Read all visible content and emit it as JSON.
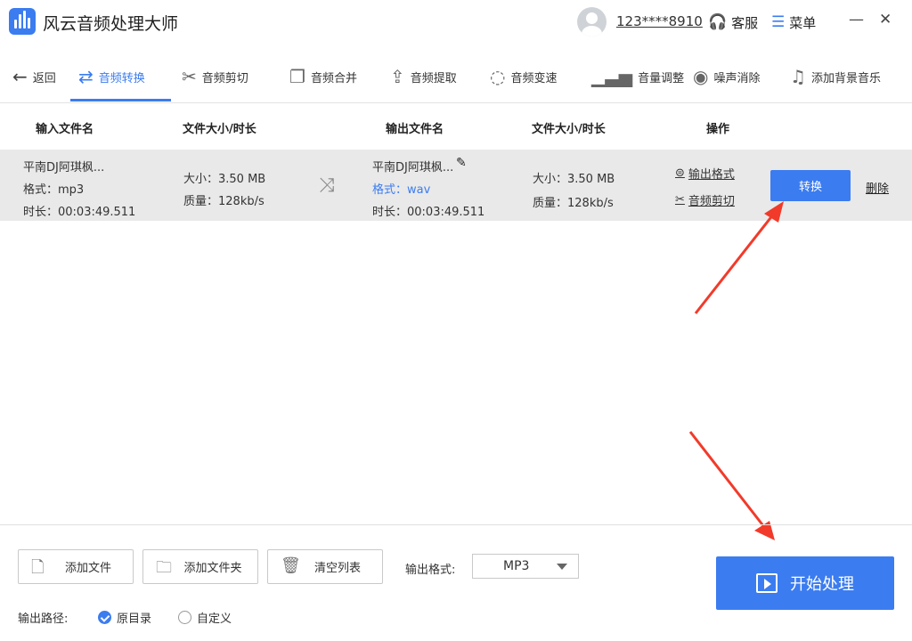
{
  "app": {
    "title": "风云音频处理大师",
    "user_id": "123****8910",
    "service_label": "客服",
    "menu_label": "菜单"
  },
  "toolbar": {
    "back": "返回",
    "items": [
      "音频转换",
      "音频剪切",
      "音频合并",
      "音频提取",
      "音频变速",
      "音量调整",
      "噪声消除",
      "添加背景音乐"
    ],
    "active_index": 0
  },
  "table": {
    "headers": [
      "输入文件名",
      "文件大小/时长",
      "输出文件名",
      "文件大小/时长",
      "操作"
    ],
    "rows": [
      {
        "input_name": "平南DJ阿琪枫...",
        "input_format": "格式：mp3",
        "input_duration": "时长：00:03:49.511",
        "input_size": "大小：3.50 MB",
        "input_quality": "质量：128kb/s",
        "output_name": "平南DJ阿琪枫...",
        "output_format": "格式：wav",
        "output_duration": "时长：00:03:49.511",
        "output_size": "大小：3.50 MB",
        "output_quality": "质量：128kb/s",
        "op_format": "输出格式",
        "op_cut": "音频剪切",
        "convert_label": "转换",
        "delete_label": "删除"
      }
    ]
  },
  "footer": {
    "add_file": "添加文件",
    "add_folder": "添加文件夹",
    "clear_list": "清空列表",
    "output_format_label": "输出格式:",
    "output_format_value": "MP3",
    "output_path_label": "输出路径:",
    "path_options": [
      "原目录",
      "自定义"
    ],
    "path_selected": 0,
    "start_label": "开始处理"
  },
  "colors": {
    "accent": "#3b7cf0",
    "annotation_arrow": "#f23a2a"
  }
}
